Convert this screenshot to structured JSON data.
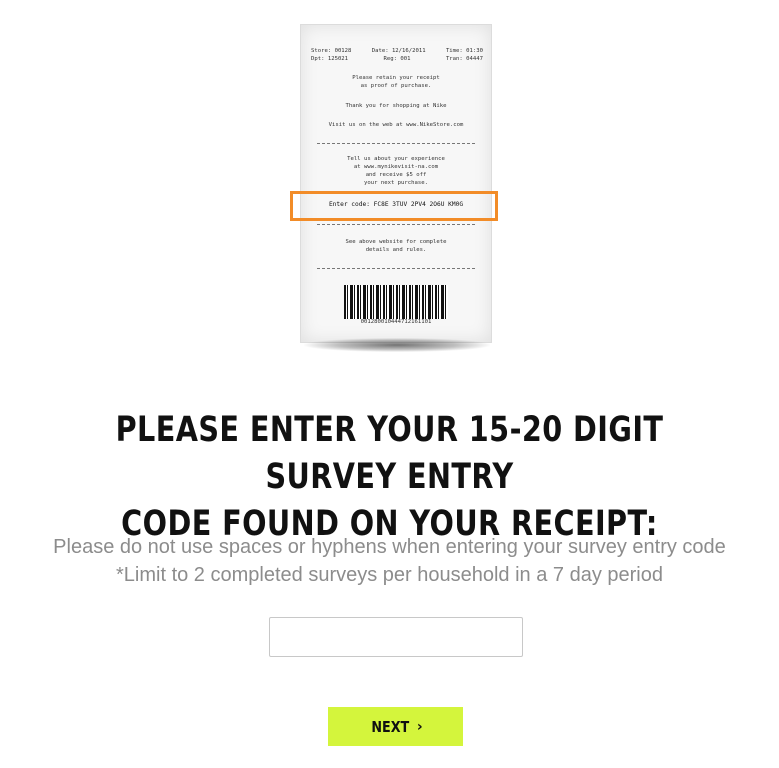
{
  "receipt": {
    "header_left": [
      "Store: 00128",
      "Dpt: 125021"
    ],
    "header_mid": [
      "Date: 12/16/2011",
      "Reg: 001"
    ],
    "header_right": [
      "Time: 01:30",
      "Tran: 04447"
    ],
    "retain_line1": "Please retain your receipt",
    "retain_line2": "as proof of purchase.",
    "thanks": "Thank you for shopping at Nike",
    "visit": "Visit us on the web at www.NikeStore.com",
    "tell_line1": "Tell us about your experience",
    "tell_line2": "at www.mynikevisit-na.com",
    "tell_line3": "and receive $5 off",
    "tell_line4": "your next purchase.",
    "code_line": "Enter code: FC8E 3TUV 2PV4 2O6U KM0G",
    "see_line1": "See above website for complete",
    "see_line2": "details and rules.",
    "barcode_number": "001280010444712161101"
  },
  "heading": {
    "line1": "PLEASE ENTER YOUR 15-20 DIGIT SURVEY ENTRY",
    "line2": "CODE FOUND ON YOUR RECEIPT:"
  },
  "instructions": {
    "line1": "Please do not use spaces or hyphens when entering your survey entry code",
    "line2": "*Limit to 2 completed surveys per household in a 7 day period"
  },
  "code_input": {
    "value": "",
    "placeholder": ""
  },
  "next_button": {
    "label": "NEXT",
    "icon": "chevron-right-icon"
  },
  "colors": {
    "accent": "#d4f53c",
    "highlight": "#f28c28"
  }
}
